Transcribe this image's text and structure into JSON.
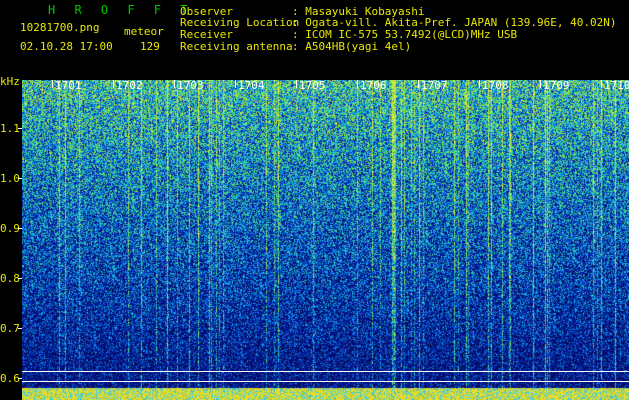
{
  "header": {
    "program": "H R O F F T",
    "filename": "10281700.png",
    "datetime": "02.10.28 17:00",
    "meteor_label": "meteor",
    "meteor_count": "129",
    "fields": [
      {
        "label": "Observer",
        "value": ": Masayuki Kobayashi"
      },
      {
        "label": "Receiving Location",
        "value": ": Ogata-vill. Akita-Pref. JAPAN (139.96E, 40.02N)"
      },
      {
        "label": "Receiver",
        "value": ": ICOM IC-575 53.7492(@LCD)MHz USB"
      },
      {
        "label": "Receiving antenna",
        "value": ": A504HB(yagi 4el)"
      }
    ]
  },
  "axis": {
    "unit": "kHz",
    "y_ticks": [
      "1.1",
      "1.0",
      "0.9",
      "0.8",
      "0.7",
      "0.6"
    ],
    "time_ticks": [
      "1701",
      "1702",
      "1703",
      "1704",
      "1705",
      "1706",
      "1707",
      "1708",
      "1709",
      "1710"
    ]
  },
  "colors": {
    "background": "#000000",
    "header_text": "#e8e800",
    "program_text": "#00c800",
    "noise_low": "#0a1aa0",
    "noise_high": "#40e0a0",
    "meteor_band": "#e8e800"
  }
}
